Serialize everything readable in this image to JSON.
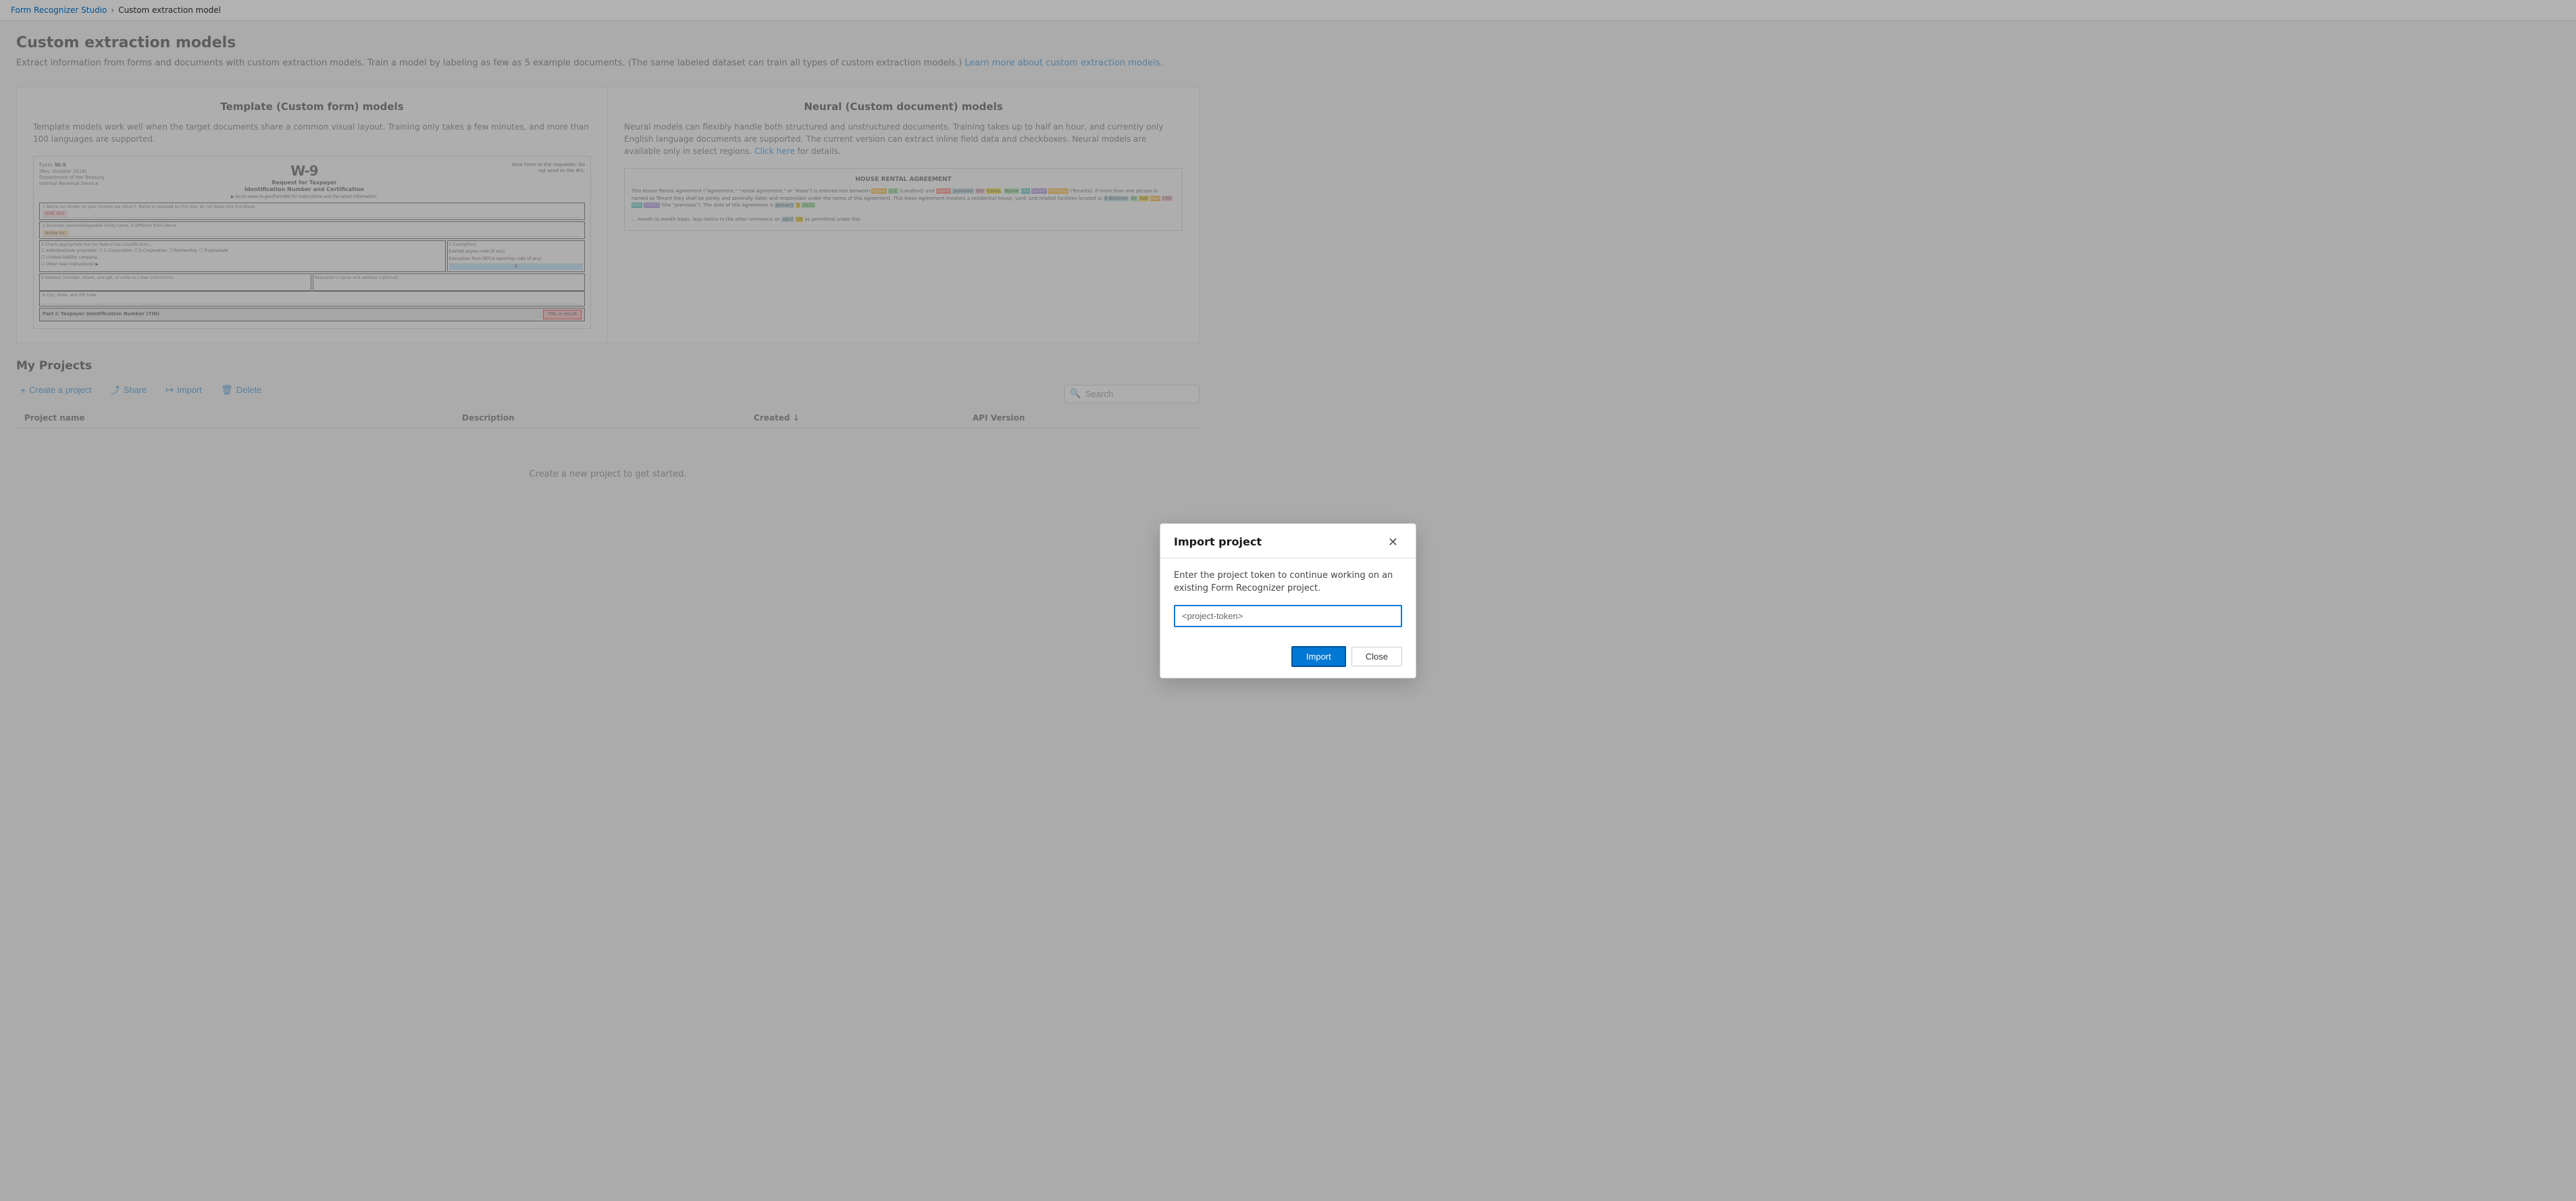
{
  "breadcrumb": {
    "home": "Form Recognizer Studio",
    "current": "Custom extraction model",
    "separator": "›"
  },
  "page": {
    "title": "Custom extraction models",
    "description": "Extract information from forms and documents with custom extraction models. Train a model by labeling as few as 5 example documents. (The same labeled dataset can train all types of custom extraction models.)",
    "learn_more_text": "Learn more about custom extraction models.",
    "learn_more_href": "#"
  },
  "model_columns": {
    "left": {
      "title": "Template (Custom form) models",
      "description": "Template models work well when the target documents share a common visual layout. Training only takes a few minutes, and more than 100 languages are supported."
    },
    "right": {
      "title": "Neural (Custom document) models",
      "description": "Neural models can flexibly handle both structured and unstructured documents. Training takes up to half an hour, and currently only English language documents are supported. The current version can extract inline field data and checkboxes. Neural models are available only in select regions.",
      "click_here": "Click here",
      "for_details": " for details."
    }
  },
  "my_projects": {
    "title": "My Projects",
    "toolbar": {
      "create": "Create a project",
      "share": "Share",
      "import": "Import",
      "delete": "Delete"
    },
    "table_headers": {
      "project_name": "Project name",
      "description": "Description",
      "created": "Created ↓",
      "api_version": "API Version"
    },
    "empty_message": "Create a new project to get started.",
    "search_placeholder": "Search"
  },
  "import_dialog": {
    "title": "Import project",
    "description": "Enter the project token to continue working on an existing Form Recognizer project.",
    "input_placeholder": "<project-token>",
    "import_btn": "Import",
    "close_btn": "Close"
  }
}
